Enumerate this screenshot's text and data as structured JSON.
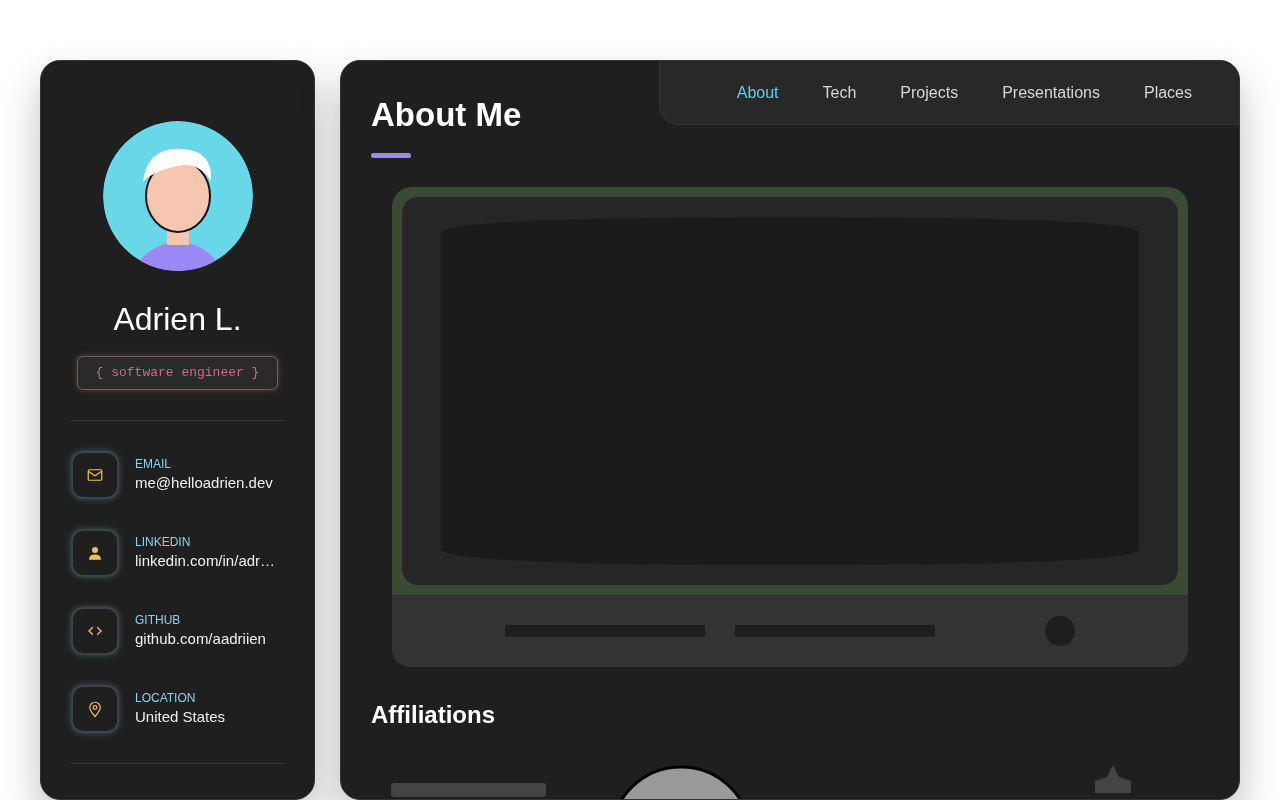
{
  "profile": {
    "name": "Adrien L.",
    "role": "{ software engineer }"
  },
  "contacts": [
    {
      "kind": "email",
      "label": "EMAIL",
      "value": "me@helloadrien.dev"
    },
    {
      "kind": "person",
      "label": "LINKEDIN",
      "value": "linkedin.com/in/adr…"
    },
    {
      "kind": "code",
      "label": "GITHUB",
      "value": "github.com/aadriien"
    },
    {
      "kind": "location",
      "label": "LOCATION",
      "value": "United States"
    }
  ],
  "tabs": [
    {
      "label": "About",
      "selected": true
    },
    {
      "label": "Tech",
      "selected": false
    },
    {
      "label": "Projects",
      "selected": false
    },
    {
      "label": "Presentations",
      "selected": false
    },
    {
      "label": "Places",
      "selected": false
    }
  ],
  "heading": "About Me",
  "affiliations": {
    "title": "Affiliations"
  }
}
